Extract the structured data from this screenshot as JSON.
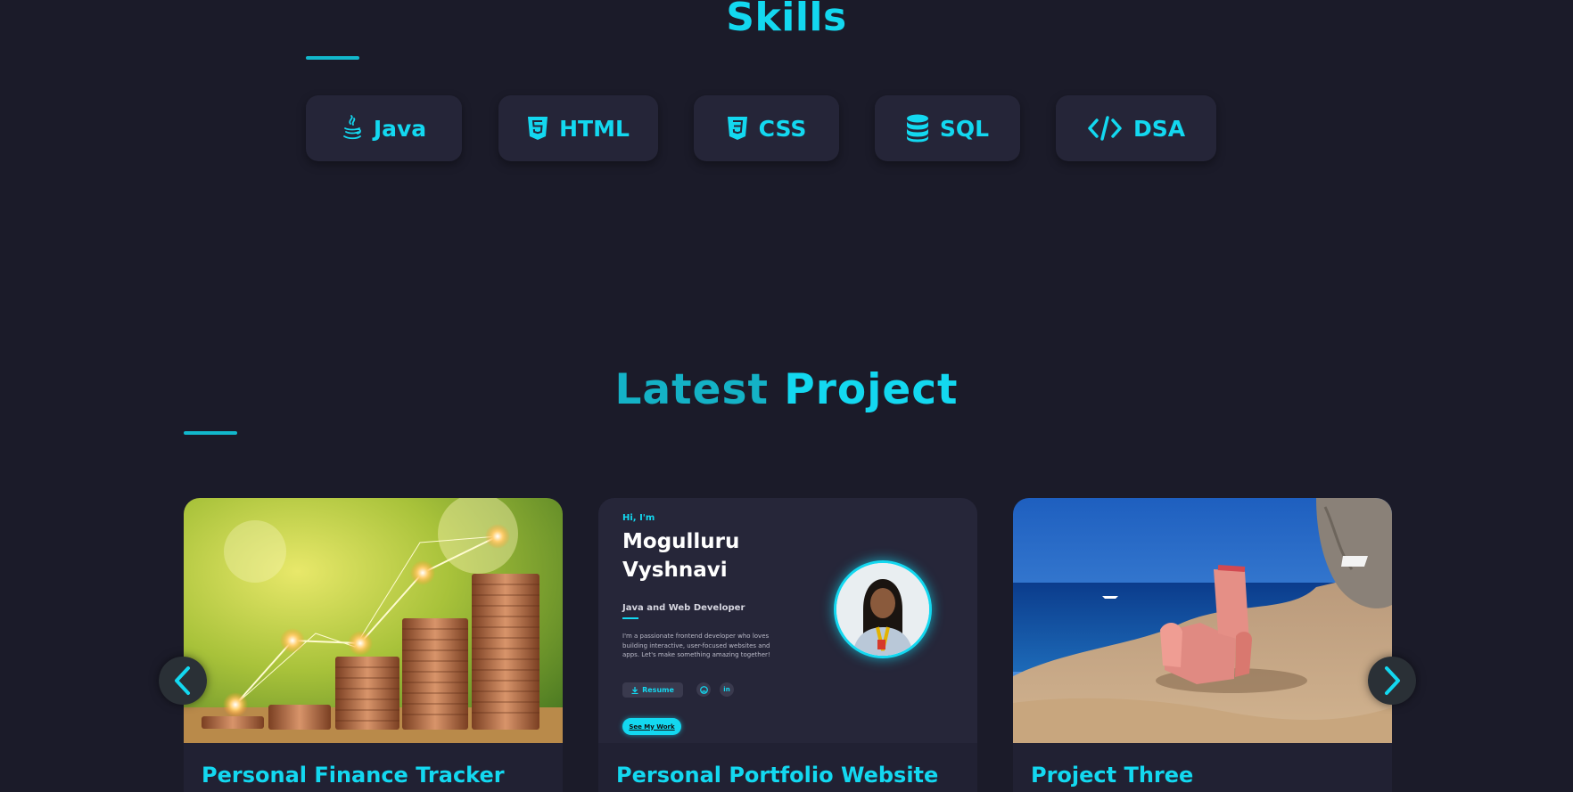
{
  "skills": {
    "title": "Skills",
    "items": [
      {
        "label": "Java",
        "icon": "java-icon"
      },
      {
        "label": "HTML",
        "icon": "html5-icon"
      },
      {
        "label": "CSS",
        "icon": "css3-icon"
      },
      {
        "label": "SQL",
        "icon": "database-icon"
      },
      {
        "label": "DSA",
        "icon": "code-icon"
      }
    ]
  },
  "projects": {
    "title_part1": "Latest",
    "title_part2": "Project",
    "cards": [
      {
        "title": "Personal Finance Tracker",
        "image": "coin-stacks-growth-chart"
      },
      {
        "title": "Personal Portfolio Website",
        "image": "portfolio-site-preview"
      },
      {
        "title": "Project Three",
        "image": "armchair-on-seaside-rock"
      }
    ],
    "prev_icon": "chevron-left-icon",
    "next_icon": "chevron-right-icon"
  },
  "portfolio_preview": {
    "greeting": "Hi, I'm",
    "name_line1": "Mogulluru",
    "name_line2": "Vyshnavi",
    "role": "Java and Web Developer",
    "description": "I'm a passionate frontend developer who loves building interactive, user-focused websites and apps. Let's make something amazing together!",
    "resume_label": "Resume",
    "social_github": "github-icon",
    "social_linkedin": "in",
    "cta_label": "See My Work"
  },
  "colors": {
    "background": "#1b1b29",
    "accent": "#13d8f0",
    "card": "#252538"
  }
}
